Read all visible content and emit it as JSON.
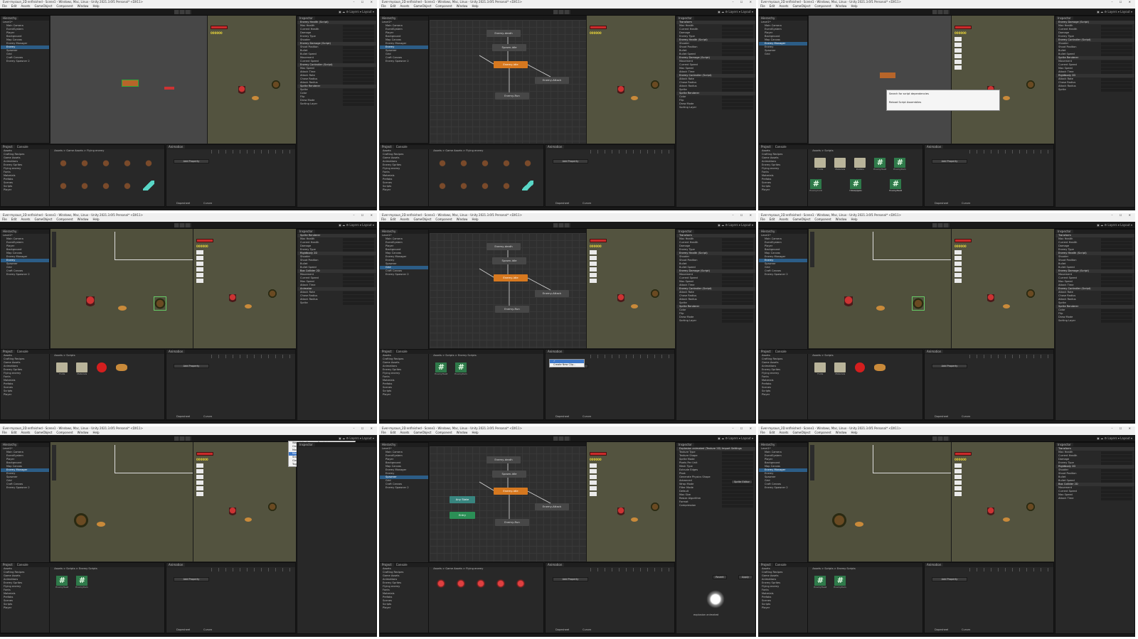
{
  "window_title": "Ever-mysaun_2D enfinished - Scene1 - Windows, Mac, Linux - Unity 2021.3.6f1 Personal* <DX11>",
  "menu": [
    "File",
    "Edit",
    "Assets",
    "GameObject",
    "Component",
    "Window",
    "Help"
  ],
  "tabs": {
    "hierarchy": "Hierarchy",
    "scene": "Scene",
    "animator": "Animator",
    "game": "Game",
    "inspector": "Inspector",
    "project": "Project",
    "console": "Console",
    "animation": "Animation"
  },
  "hierarchy_items": [
    "Level1*",
    "Main Camera",
    "EventSystem",
    "Player",
    "Background",
    "Map Canvas",
    "Enemy Manager",
    "Enemy",
    "Spawner",
    "Grid",
    "Craft Canvas",
    "Enemy Spawner 2"
  ],
  "inspector": {
    "components": [
      "Transform",
      "Enemy Health (Script)",
      "Enemy Damage (Script)",
      "Enemy Controller (Script)",
      "Sprite Renderer",
      "Rigidbody 2D",
      "Box Collider 2D",
      "Animator"
    ],
    "fields": [
      "Max Health",
      "Current Health",
      "Damage",
      "Enemy Type",
      "Shooter",
      "Shoot Position",
      "Bullet",
      "Bullet Speed",
      "Movement",
      "Current Speed",
      "Max Speed",
      "Attack Time",
      "Attack Rate",
      "Chase Radius",
      "Attack Radius",
      "Sprite",
      "Color",
      "Flip",
      "Draw Mode",
      "Sorting Layer",
      "Order in Layer"
    ],
    "add_component": "Add Component"
  },
  "animator_states": {
    "death": "Enemy-death",
    "spawn": "Spawn-idle",
    "idle": "Enemy-idle",
    "attack": "Enemy-Attack",
    "run": "Enemy-Run",
    "any_state": "Any State",
    "entry": "Entry"
  },
  "project": {
    "breadcrumb_1": "Assets > Game Assets > Flying enemy",
    "breadcrumb_2": "Assets > Scripts",
    "breadcrumb_3": "Assets > Scripts > Enemy Scripts",
    "folders": [
      "Assets",
      "Crafting Recipes",
      "Game Assets",
      "Animations",
      "Enemy Sprites",
      "Flying enemy",
      "Fonts",
      "Materials",
      "Prefabs",
      "Scenes",
      "Scripts",
      "Player"
    ],
    "scripts": [
      "EnemyHealth",
      "EnemyDamage",
      "EnemyController",
      "EnemyAI",
      "EnemySpawner"
    ],
    "create_clip": "Create New Clip..."
  },
  "animation_panel": {
    "add_property": "Add Property",
    "dopesheet": "Dopesheet",
    "curves": "Curves"
  },
  "context_menu": {
    "items": [
      "Warn If No Cameras Rendering",
      "Clear Every Frame in Edit Mode",
      "Maximize",
      "Mute Audio",
      "Stats",
      "Gizmos",
      "Toggle Live Reload"
    ],
    "selected_index": 3
  },
  "dialog": {
    "title": "Search for script dependencies",
    "body": "Reload Script Assemblies"
  },
  "game_hud": {
    "coins": "000000"
  },
  "import_settings": {
    "header": "Explosion animated (Texture 2D) Import Settings",
    "fields": [
      "Texture Type",
      "Texture Shape",
      "Sprite Mode",
      "Pixels Per Unit",
      "Mesh Type",
      "Extrude Edges",
      "Pivot",
      "Generate Physics Shape",
      "Advanced",
      "Wrap Mode",
      "Filter Mode",
      "Default",
      "Max Size",
      "Resize Algorithm",
      "Format",
      "Compression"
    ],
    "sprite_editor": "Sprite Editor",
    "preview_label": "explosion animated",
    "apply": "Apply",
    "revert": "Revert"
  },
  "colors": {
    "editor_bg": "#191919",
    "panel_bg": "#282828",
    "scene_bg": "#474747",
    "game_bg": "#53533f",
    "node_orange": "#d6781f",
    "node_green": "#2b8f56",
    "node_teal": "#38857f",
    "selection": "#2c5d87",
    "script_icon": "#2f7a4a",
    "health_red": "#c92b2b"
  }
}
